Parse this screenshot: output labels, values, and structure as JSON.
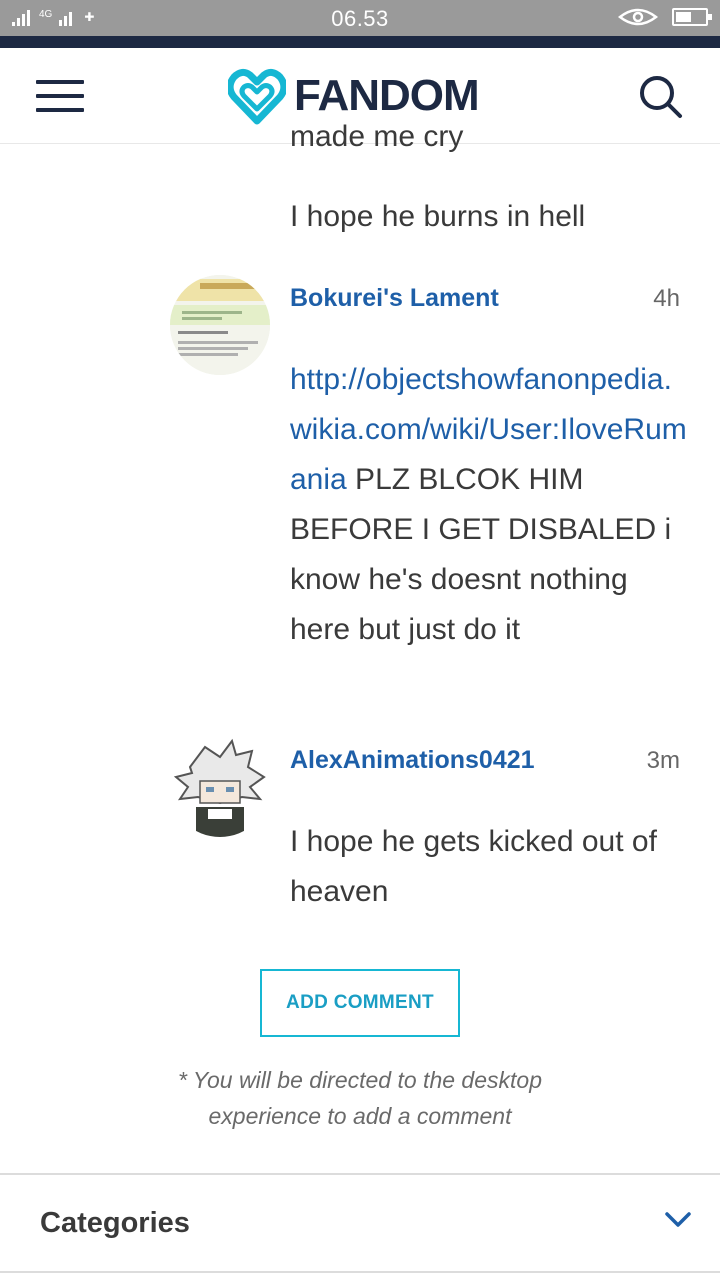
{
  "status_bar": {
    "network": "4G",
    "time": "06.53",
    "battery_level": 0.55
  },
  "header": {
    "brand": "FANDOM",
    "brand_color": "#1d2943",
    "accent_color": "#16b7d3",
    "menu_icon": "hamburger-icon",
    "search_icon": "search-icon"
  },
  "previous_comment": {
    "cutoff_line": "made me cry",
    "last_line": "I hope he burns in hell"
  },
  "comments": [
    {
      "user": "Bokurei's Lament",
      "time": "4h",
      "link": "http://objectshowfanonpedia.wikia.com/wiki/User:IloveRumania",
      "text": " PLZ BLCOK HIM BEFORE I GET DISBALED i know he's doesnt nothing here but just do it"
    },
    {
      "user": "AlexAnimations0421",
      "time": "3m",
      "text": "I hope he gets kicked out of heaven"
    }
  ],
  "add_comment": {
    "label": "ADD COMMENT",
    "note": "* You will be directed to the desktop experience to add a comment"
  },
  "categories": {
    "label": "Categories",
    "icon": "chevron-down-icon"
  }
}
